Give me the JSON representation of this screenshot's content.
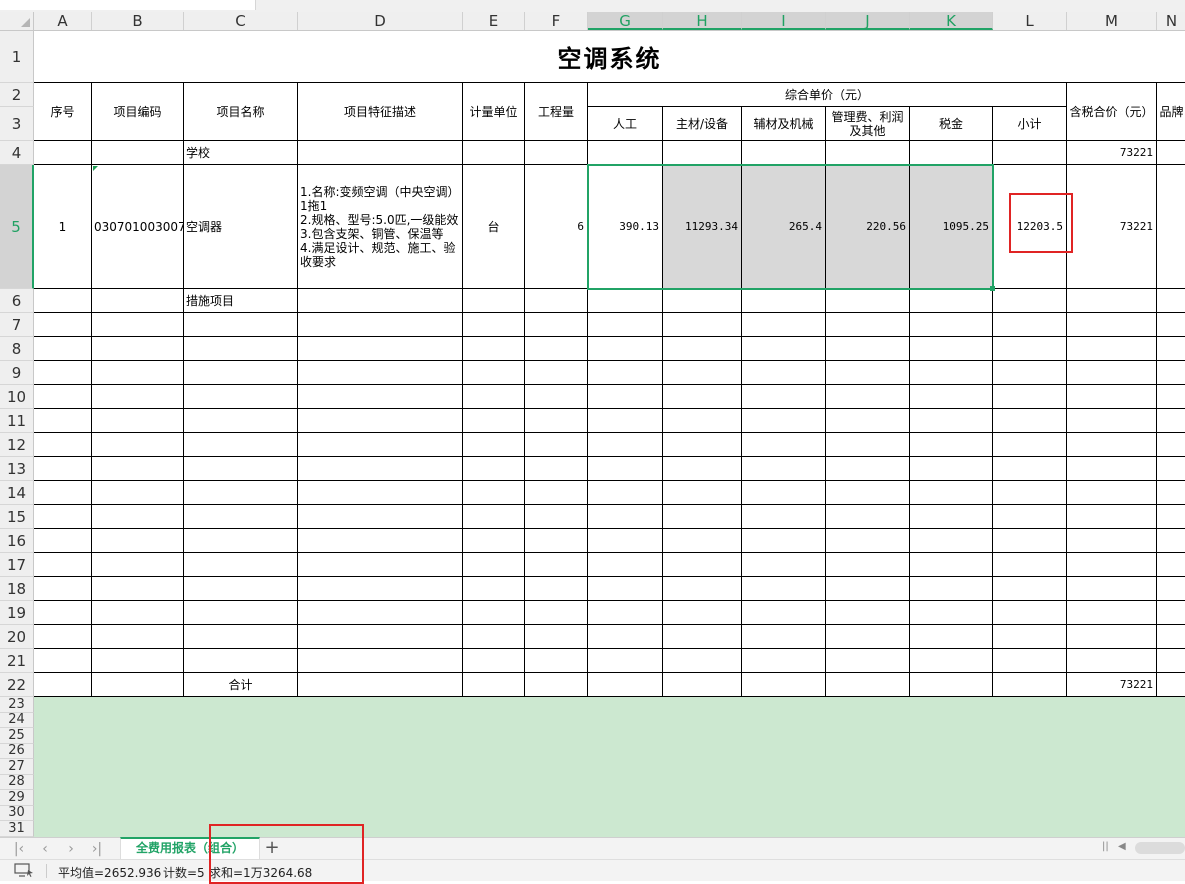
{
  "columns": [
    "A",
    "B",
    "C",
    "D",
    "E",
    "F",
    "G",
    "H",
    "I",
    "J",
    "K",
    "L",
    "M",
    "N"
  ],
  "selected_columns": [
    "G",
    "H",
    "I",
    "J",
    "K"
  ],
  "rows": [
    "1",
    "2",
    "3",
    "4",
    "5",
    "6",
    "7",
    "8",
    "9",
    "10",
    "11",
    "12",
    "13",
    "14",
    "15",
    "16",
    "17",
    "18",
    "19",
    "20",
    "21",
    "22",
    "23",
    "24",
    "25",
    "26",
    "27",
    "28",
    "29",
    "30",
    "31"
  ],
  "selected_row": "5",
  "sheet": {
    "title": "空调系统",
    "headers": {
      "seq": "序号",
      "code": "项目编码",
      "name": "项目名称",
      "desc": "项目特征描述",
      "unit": "计量单位",
      "qty": "工程量",
      "group": "综合单价（元）",
      "labor": "人工",
      "material": "主材/设备",
      "machine": "辅材及机械",
      "mgmt": "管理费、利润及其他",
      "tax": "税金",
      "subtotal": "小计",
      "total": "含税合价（元）",
      "brand": "品牌"
    },
    "row4": {
      "name": "学校",
      "total": "73221"
    },
    "row5": {
      "seq": "1",
      "code": "030701003007",
      "name": "空调器",
      "desc": "1.名称:变频空调（中央空调）1拖1\n2.规格、型号:5.0匹,一级能效\n3.包含支架、铜管、保温等\n4.满足设计、规范、施工、验收要求",
      "unit": "台",
      "qty": "6",
      "labor": "390.13",
      "material": "11293.34",
      "machine": "265.4",
      "mgmt": "220.56",
      "tax": "1095.25",
      "subtotal": "12203.5",
      "total": "73221"
    },
    "row6": {
      "name": "措施项目"
    },
    "row22": {
      "name": "合计",
      "total": "73221"
    }
  },
  "tabs": {
    "active": "全费用报表（组合）",
    "add_label": "+"
  },
  "status": {
    "avg": "平均值=2652.936",
    "count": "计数=5",
    "sum": "求和=1万3264.68"
  },
  "colors": {
    "accent": "#21a366",
    "highlight": "#e02424",
    "selection_fill": "#d8d8d8",
    "empty_area": "#cce8d0"
  }
}
